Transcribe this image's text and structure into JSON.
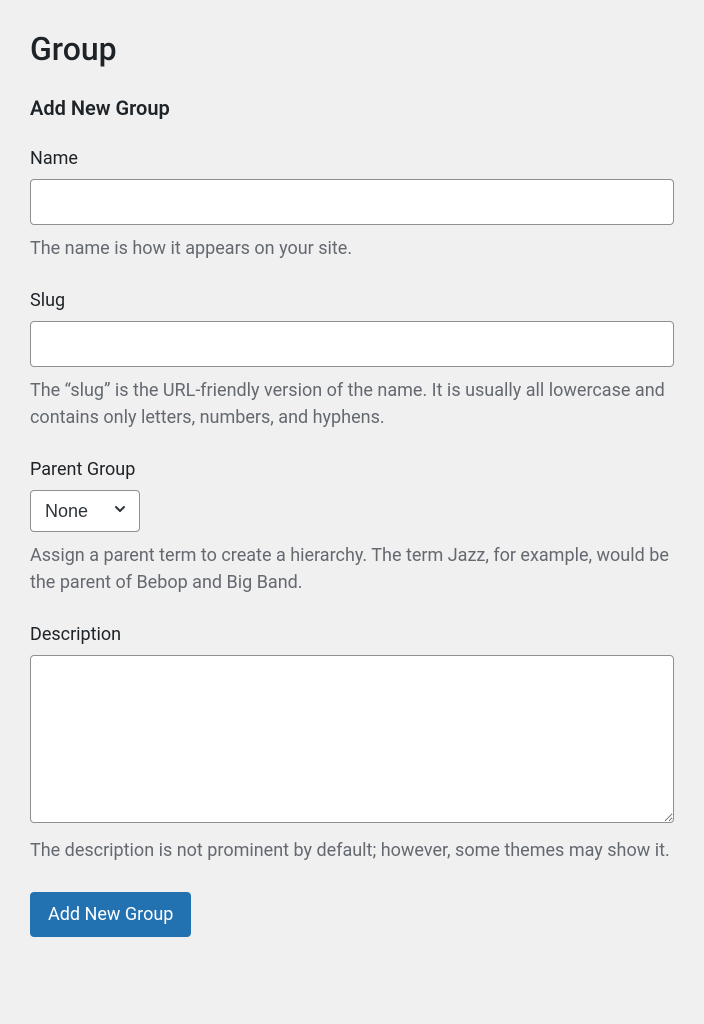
{
  "page": {
    "title": "Group",
    "form_title": "Add New Group"
  },
  "fields": {
    "name": {
      "label": "Name",
      "value": "",
      "help": "The name is how it appears on your site."
    },
    "slug": {
      "label": "Slug",
      "value": "",
      "help": "The “slug” is the URL-friendly version of the name. It is usually all lowercase and contains only letters, numbers, and hyphens."
    },
    "parent": {
      "label": "Parent Group",
      "selected": "None",
      "help": "Assign a parent term to create a hierarchy. The term Jazz, for example, would be the parent of Bebop and Big Band."
    },
    "description": {
      "label": "Description",
      "value": "",
      "help": "The description is not prominent by default; however, some themes may show it."
    }
  },
  "submit": {
    "label": "Add New Group"
  },
  "colors": {
    "primary": "#2271b1",
    "text": "#1d2327",
    "muted": "#646970",
    "border": "#8c8f94",
    "background": "#f0f0f1"
  }
}
